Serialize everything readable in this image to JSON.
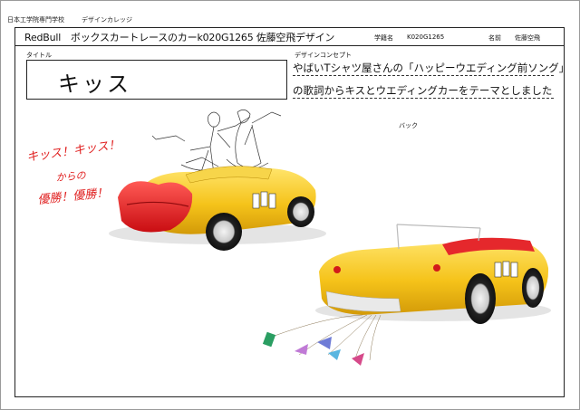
{
  "top_left": {
    "school": "日本工学院専門学校",
    "college": "デザインカレッジ"
  },
  "header": {
    "title": "RedBull　ボックスカートレースのカーk020G1265 佐藤空飛デザイン",
    "id_label": "学籍名",
    "id_value": "K020G1265",
    "name_label": "名前",
    "name_value": "佐藤空飛"
  },
  "sections": {
    "title_label": "タイトル",
    "title_value": "キッス",
    "concept_label": "デザインコンセプト",
    "concept_lines": [
      "やばいTシャツ屋さんの「ハッピーウエディング前ソング」",
      "の歌詞からキスとウエディングカーをテーマとしました"
    ],
    "back_label": "バック"
  },
  "handwriting": [
    "キッス！キッス！",
    "からの",
    "優勝！優勝！"
  ],
  "colors": {
    "car_body": "#f5c31a",
    "lips": "#e8191e",
    "handwriting": "#e02020",
    "border": "#222222"
  }
}
